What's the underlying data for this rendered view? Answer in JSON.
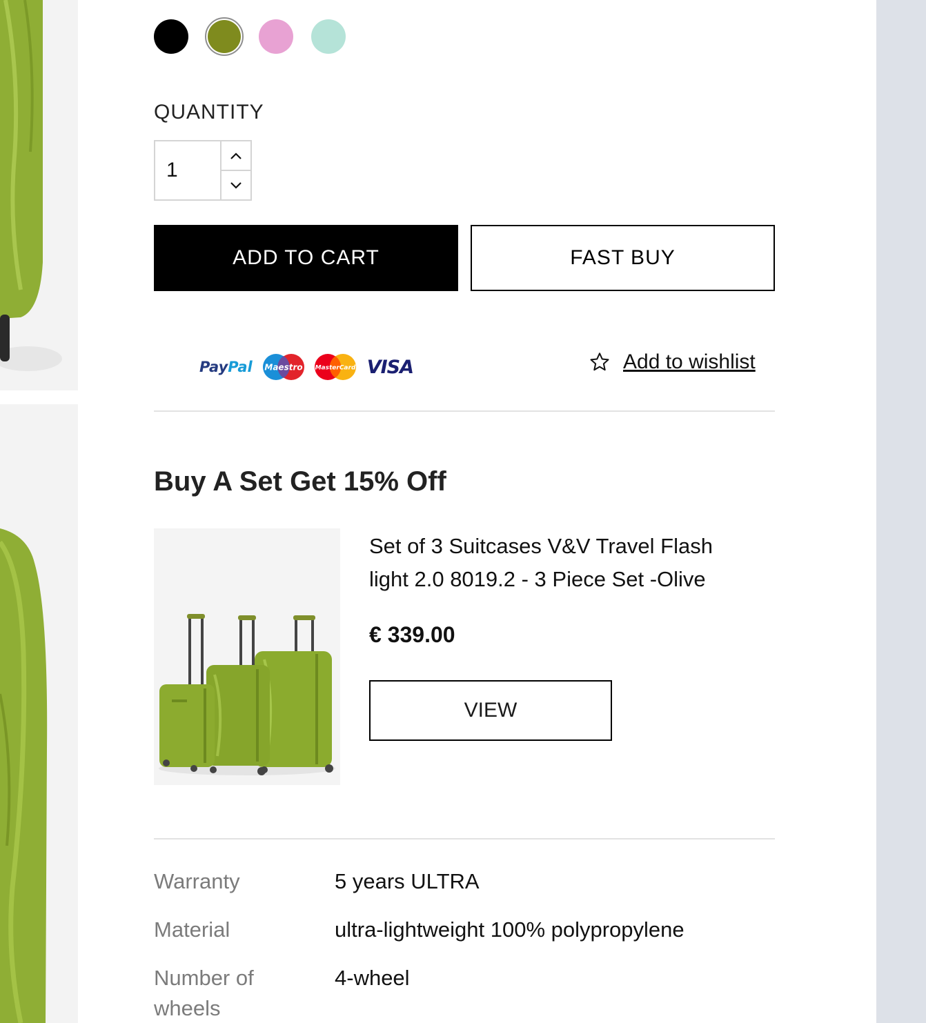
{
  "colors": {
    "swatches": [
      "#000000",
      "#7f8b1e",
      "#e8a2d3",
      "#b5e3d8"
    ],
    "selected_index": 1,
    "primary_button_bg": "#000000",
    "right_strip": "#dde1e8",
    "luggage_green": "#8fae35"
  },
  "quantity": {
    "label": "QUANTITY",
    "value": "1"
  },
  "buttons": {
    "add_to_cart": "ADD TO CART",
    "fast_buy": "FAST BUY",
    "view": "VIEW"
  },
  "payments": {
    "paypal_pay": "Pay",
    "paypal_pal": "Pal",
    "maestro": "Maestro",
    "mastercard": "MasterCard",
    "visa": "VISA"
  },
  "wishlist": {
    "label": "Add to wishlist",
    "icon": "star-outline-icon"
  },
  "bundle": {
    "title": "Buy A Set Get 15% Off",
    "product_name": "Set of 3 Suitcases V&V Travel Flash light 2.0 8019.2 - 3 Piece Set -Olive",
    "price": "€ 339.00"
  },
  "specs": [
    {
      "key": "Warranty",
      "value": "5 years ULTRA"
    },
    {
      "key": "Material",
      "value": "ultra-lightweight 100% polypropylene"
    },
    {
      "key": "Number of wheels",
      "value": "4-wheel"
    }
  ]
}
